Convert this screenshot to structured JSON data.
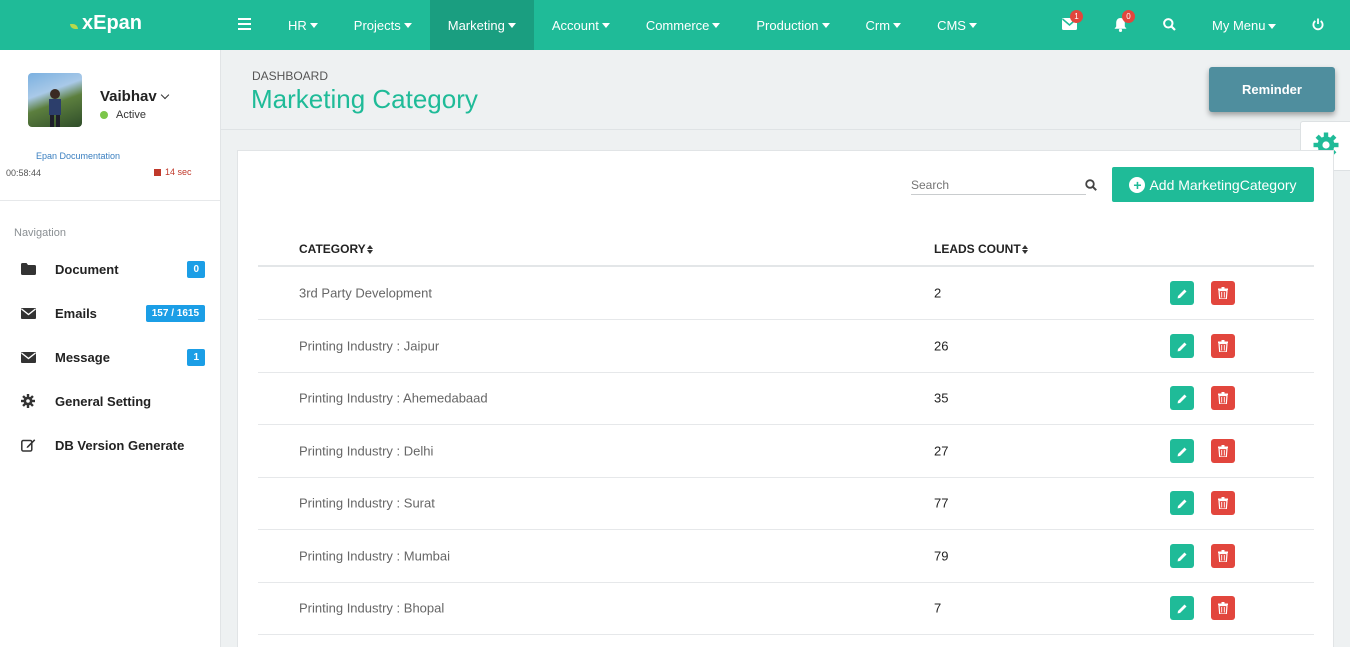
{
  "app": {
    "logo": "xEpan"
  },
  "topnav": {
    "items": [
      {
        "label": "HR"
      },
      {
        "label": "Projects"
      },
      {
        "label": "Marketing",
        "active": true
      },
      {
        "label": "Account"
      },
      {
        "label": "Commerce"
      },
      {
        "label": "Production"
      },
      {
        "label": "Crm"
      },
      {
        "label": "CMS"
      }
    ],
    "mail_badge": "1",
    "bell_badge": "0",
    "my_menu": "My Menu",
    "icons": [
      "menu-icon",
      "envelope-icon",
      "bell-icon",
      "search-icon",
      "power-icon"
    ]
  },
  "user": {
    "name": "Vaibhav",
    "status": "Active",
    "doc_link": "Epan Documentation",
    "timer": "00:58:44",
    "seconds": "14 sec"
  },
  "sidebar": {
    "heading": "Navigation",
    "items": [
      {
        "label": "Document",
        "badge": "0",
        "icon": "folder-icon"
      },
      {
        "label": "Emails",
        "badge": "157 / 1615",
        "icon": "envelope-icon"
      },
      {
        "label": "Message",
        "badge": "1",
        "icon": "envelope-icon"
      },
      {
        "label": "General Setting",
        "badge": null,
        "icon": "gear-icon"
      },
      {
        "label": "DB Version Generate",
        "badge": null,
        "icon": "edit-icon"
      }
    ]
  },
  "page": {
    "breadcrumb": "DASHBOARD",
    "title": "Marketing Category",
    "reminder_label": "Reminder",
    "search_placeholder": "Search",
    "add_label": "Add MarketingCategory"
  },
  "table": {
    "columns": [
      "CATEGORY",
      "LEADS COUNT"
    ],
    "rows": [
      {
        "category": "3rd Party Development",
        "leads": "2"
      },
      {
        "category": "Printing Industry : Jaipur",
        "leads": "26"
      },
      {
        "category": "Printing Industry : Ahemedabaad",
        "leads": "35"
      },
      {
        "category": "Printing Industry : Delhi",
        "leads": "27"
      },
      {
        "category": "Printing Industry : Surat",
        "leads": "77"
      },
      {
        "category": "Printing Industry : Mumbai",
        "leads": "79"
      },
      {
        "category": "Printing Industry : Bhopal",
        "leads": "7"
      }
    ]
  },
  "colors": {
    "brand": "#1fbb98",
    "danger": "#e2463d",
    "badge": "#1b9ee6",
    "reminder": "#4f8e9e"
  }
}
